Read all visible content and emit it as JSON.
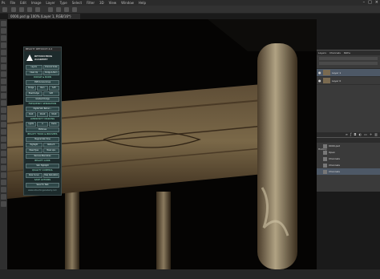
{
  "menu": {
    "items": [
      "Ps",
      "File",
      "Edit",
      "Image",
      "Layer",
      "Type",
      "Select",
      "Filter",
      "3D",
      "View",
      "Window",
      "Help"
    ]
  },
  "document": {
    "tab_title": "0000.psd @ 100% (Layer 1, RGB/16*)"
  },
  "plugin": {
    "title": "BEAUTY RETOUCH 4.0",
    "logo_line1": "RETOUCHING",
    "logo_line2": "ACADEMY",
    "sections": [
      {
        "heading": "",
        "rows": [
          [
            "Layers",
            "Channel Scale"
          ],
          [
            "Clean Up",
            "Dodge & Burn"
          ]
        ]
      },
      {
        "heading": "DODGE & BURN",
        "rows": [
          [
            "DSB Curves Group"
          ],
          [
            "Dodge",
            "Burn",
            "Soft"
          ],
          [
            "Pixel Dodge",
            "Soft"
          ],
          [
            "Gradient Dodge"
          ]
        ]
      },
      {
        "heading": "FREQUENCY SEPARATION",
        "rows": [
          [
            "Digital Skin Retouc..."
          ],
          [
            "8-bit",
            "16-bit",
            "32-bit"
          ]
        ]
      },
      {
        "heading": "LUMINOSITY MASKING",
        "rows": [
          [
            "Lights",
            "A",
            "Darks"
          ],
          [
            "Midtones"
          ]
        ]
      },
      {
        "heading": "BEAUTY TRICK & BRUSHES",
        "rows": [
          [
            "Magical Skin Tone"
          ],
          [
            "Highlight",
            "Retouch"
          ],
          [
            "Mask Eyes",
            "Mask Lips"
          ],
          [
            "Remove Blemishes"
          ]
        ]
      },
      {
        "heading": "BEAUTY LOOK",
        "rows": [
          [
            "Skin Highlight"
          ]
        ]
      },
      {
        "heading": "QUALITY CONTROL",
        "rows": [
          [
            "Solar Curve",
            "Help Saturation"
          ]
        ]
      },
      {
        "heading": "SAVE ACTIONS",
        "rows": [
          [
            "Save For Web"
          ]
        ]
      }
    ],
    "footer": "www.retouchingacademy.com"
  },
  "layers_panel": {
    "tabs": [
      "Layers",
      "Channels",
      "Paths"
    ],
    "layers": [
      {
        "name": "Layer 1",
        "selected": true
      },
      {
        "name": "Layer 0",
        "selected": false
      }
    ],
    "footer_icons": [
      "link-icon",
      "fx-icon",
      "mask-icon",
      "adjustment-icon",
      "folder-icon",
      "new-layer-icon",
      "trash-icon"
    ]
  },
  "history_panel": {
    "tab": "History",
    "snapshot": "0000.psd",
    "states": [
      "Open",
      "Channels",
      "Channels",
      "Channels"
    ]
  },
  "colors": {
    "wood_light": "#8a7a60",
    "wood_dark": "#3c2e1e",
    "accent": "#4d5866",
    "plugin_bg": "#1d2b2c"
  }
}
